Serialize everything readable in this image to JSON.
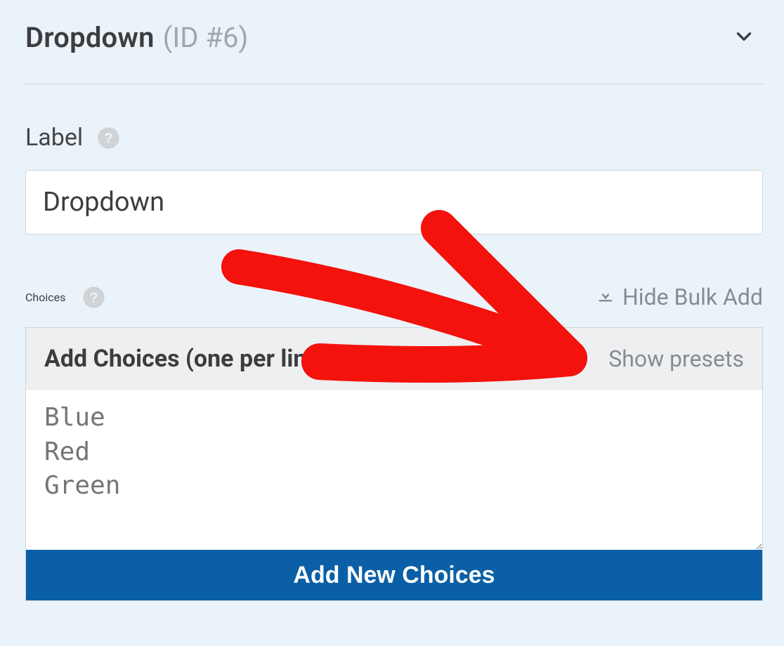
{
  "header": {
    "title": "Dropdown",
    "id_text": "(ID #6)"
  },
  "label_section": {
    "label": "Label",
    "value": "Dropdown"
  },
  "choices_section": {
    "label": "Choices",
    "bulk_toggle_label": "Hide Bulk Add",
    "bulk_title": "Add Choices (one per line)",
    "presets_label": "Show presets",
    "placeholder": "Blue\nRed\nGreen",
    "add_button_label": "Add New Choices"
  }
}
